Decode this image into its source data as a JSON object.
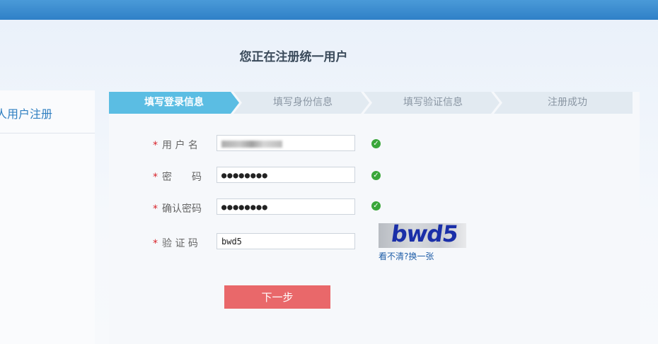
{
  "page": {
    "title": "您正在注册统一用户"
  },
  "sidebar": {
    "title": "人用户注册"
  },
  "steps": [
    {
      "label": "填写登录信息",
      "active": true
    },
    {
      "label": "填写身份信息",
      "active": false
    },
    {
      "label": "填写验证信息",
      "active": false
    },
    {
      "label": "注册成功",
      "active": false
    }
  ],
  "form": {
    "required_mark": "*",
    "username": {
      "label": "用 户 名"
    },
    "password": {
      "label": "密　　码",
      "value": "●●●●●●●●"
    },
    "confirm": {
      "label": "确认密码",
      "value": "●●●●●●●●"
    },
    "captcha": {
      "label": "验 证 码",
      "value": "bwd5",
      "image_text": "bwd5",
      "refresh_label": "看不清?换一张"
    }
  },
  "actions": {
    "next_label": "下一步"
  },
  "colors": {
    "topbar": "#2f80c7",
    "step_active": "#5bbde3",
    "step_inactive": "#e2eaf1",
    "check": "#3aa63a",
    "next_button": "#e9686a",
    "required": "#d8232a"
  },
  "icons": {
    "valid": "check-circle-icon"
  }
}
